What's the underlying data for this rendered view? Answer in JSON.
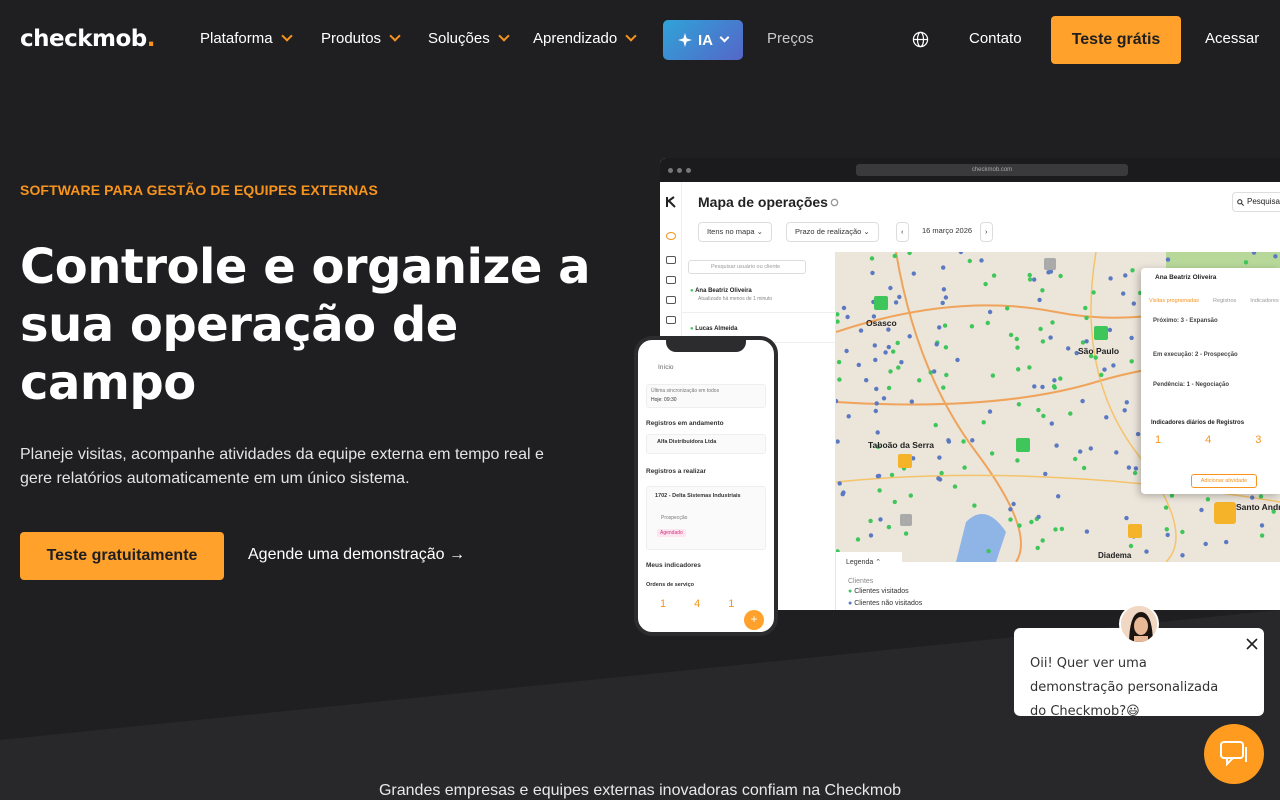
{
  "nav": {
    "logo": "checkmob",
    "items": [
      "Plataforma",
      "Produtos",
      "Soluções",
      "Aprendizado"
    ],
    "ia_label": "IA",
    "precos": "Preços",
    "contato": "Contato",
    "cta": "Teste grátis",
    "acessar": "Acessar"
  },
  "hero": {
    "eyebrow": "SOFTWARE PARA GESTÃO DE EQUIPES EXTERNAS",
    "headline": "Controle e organize a sua operação de campo",
    "subtext": "Planeje visitas, acompanhe atividades da equipe externa em tempo real e gere relatórios automaticamente em um único sistema.",
    "cta_primary": "Teste gratuitamente",
    "cta_secondary": "Agende uma demonstração →"
  },
  "desktop": {
    "url": "checkmob.com",
    "title": "Mapa de operações",
    "search": "Pesquisar",
    "filter_items": "Itens no mapa",
    "filter_deadline": "Prazo de realização",
    "date": "16 março 2026",
    "list_search": "Pesquisar usuário ou cliente",
    "users": [
      {
        "name": "Ana Beatriz Oliveira",
        "status": "Atualizado há menos de 1 minuto"
      },
      {
        "name": "Lucas Almeida",
        "status": ""
      }
    ],
    "map_labels": [
      "Osasco",
      "São Paulo",
      "Taboão da Serra",
      "Santo André",
      "Diadema"
    ],
    "legend_title": "Legenda",
    "legend_group": "Clientes",
    "legend_visited": "Clientes visitados",
    "legend_not_visited": "Clientes não visitados",
    "card": {
      "user": "Ana Beatriz Oliveira",
      "tabs": [
        "Visitas programadas",
        "Registros",
        "Indicadores"
      ],
      "visits": [
        "Próximo: 3 - Expansão",
        "Em execução: 2 - Prospecção",
        "Pendência: 1 - Negociação"
      ],
      "indicators_title": "Indicadores diários de Registros",
      "indicators": [
        "1",
        "4",
        "3"
      ],
      "add_button": "Adicionar atividade"
    }
  },
  "phone": {
    "header": "Início",
    "sync": "Última sincronização em todos",
    "sync_time": "Hoje: 09:30",
    "section_in_progress": "Registros em andamento",
    "in_progress_item": "Alfa Distribuidora Ltda",
    "section_to_do": "Registros a realizar",
    "todo_item": "1702 - Delta Sistemas Industriais",
    "todo_type": "Prospecção",
    "todo_badge": "Agendado",
    "section_indicators": "Meus indicadores",
    "orders": "Ordens de serviço",
    "indicator_values": [
      "1",
      "4",
      "1"
    ]
  },
  "chat": {
    "message": "Oii! Quer ver uma demonstração personalizada do Checkmob?😃"
  },
  "trust": "Grandes empresas e equipes externas inovadoras confiam na Checkmob",
  "colors": {
    "background": "#1f1f21",
    "accent": "#ffa12a",
    "eyebrow": "#f7941d",
    "ia_gradient_start": "#2fa3d8",
    "ia_gradient_end": "#5566c8",
    "visited_dot": "#3ec65a",
    "not_visited_dot": "#5b79c2"
  }
}
